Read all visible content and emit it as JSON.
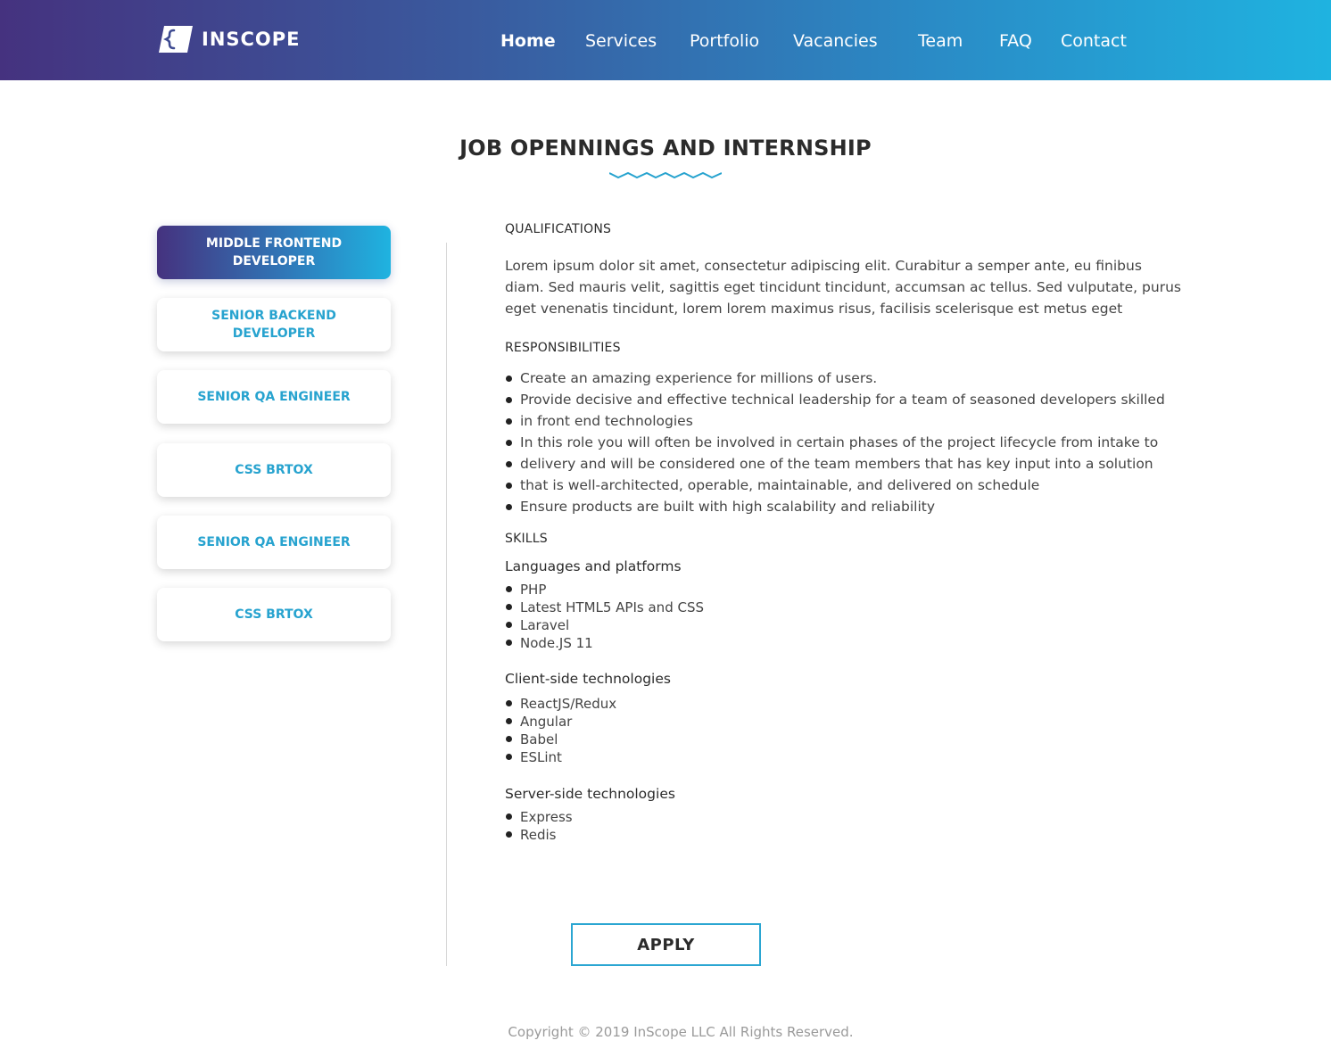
{
  "header": {
    "logo_text": "INSCOPE",
    "nav": [
      {
        "label": "Home",
        "active": true
      },
      {
        "label": "Services",
        "active": false
      },
      {
        "label": "Portfolio",
        "active": false
      },
      {
        "label": "Vacancies",
        "active": false
      },
      {
        "label": "Team",
        "active": false
      },
      {
        "label": "FAQ",
        "active": false
      },
      {
        "label": "Contact",
        "active": false
      }
    ]
  },
  "page": {
    "title": "JOB OPENNINGS AND INTERNSHIP"
  },
  "jobs": [
    {
      "label": "MIDDLE FRONTEND DEVELOPER",
      "active": true
    },
    {
      "label": "SENIOR BACKEND DEVELOPER",
      "active": false
    },
    {
      "label": "SENIOR QA ENGINEER",
      "active": false
    },
    {
      "label": "CSS BRTOX",
      "active": false
    },
    {
      "label": "SENIOR QA ENGINEER",
      "active": false
    },
    {
      "label": "CSS BRTOX",
      "active": false
    }
  ],
  "content": {
    "qualifications_heading": "QUALIFICATIONS",
    "qualifications_text": "Lorem ipsum dolor sit amet, consectetur adipiscing elit. Curabitur a semper ante, eu finibus diam. Sed mauris velit, sagittis eget tincidunt tincidunt, accumsan ac tellus. Sed vulputate, purus eget venenatis tincidunt, lorem lorem maximus risus, facilisis scelerisque est metus eget",
    "responsibilities_heading": "RESPONSIBILITIES",
    "responsibilities": [
      "Create an amazing experience for millions of users.",
      "Provide decisive and effective technical leadership for a team of seasoned developers skilled",
      "in front end technologies",
      "In this role you will often be involved in certain phases of the project lifecycle from intake to",
      "delivery and will be considered one of the team members that has key input into a solution",
      "that is well-architected, operable, maintainable, and delivered on schedule",
      "Ensure products are built with high scalability and reliability"
    ],
    "skills_heading": "SKILLS",
    "skill_groups": [
      {
        "title": "Languages and platforms",
        "items": [
          "PHP",
          "Latest HTML5 APIs and CSS",
          "Laravel",
          "Node.JS 11"
        ]
      },
      {
        "title": "Client-side technologies",
        "items": [
          "ReactJS/Redux",
          "Angular",
          "Babel",
          "ESLint"
        ]
      },
      {
        "title": "Server-side technologies",
        "items": [
          "Express",
          "Redis"
        ]
      }
    ],
    "apply_label": "APPLY"
  },
  "footer": {
    "copyright": "Copyright © 2019 InScope LLC All Rights Reserved."
  },
  "colors": {
    "accent": "#27a3cf",
    "gradient_start": "#45327f",
    "gradient_end": "#1fb3e0"
  }
}
